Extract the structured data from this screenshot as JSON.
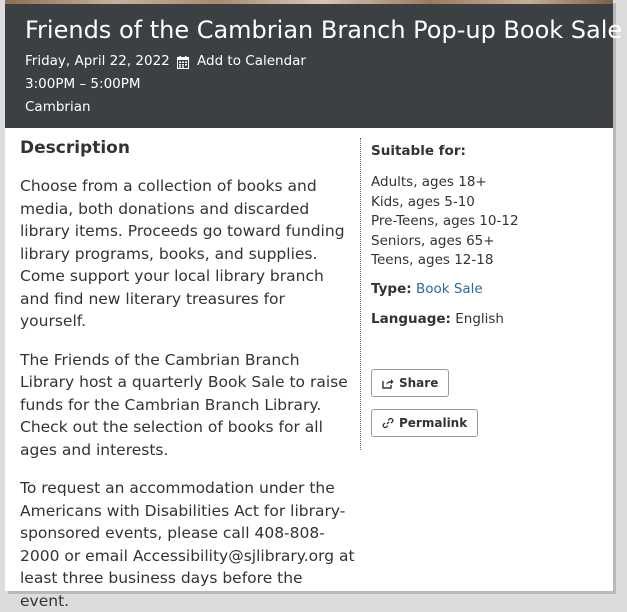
{
  "event": {
    "title": "Friends of the Cambrian Branch Pop-up Book Sale",
    "date": "Friday, April 22, 2022",
    "add_to_calendar": "Add to Calendar",
    "time": "3:00PM – 5:00PM",
    "location": "Cambrian"
  },
  "description": {
    "heading": "Description",
    "paragraphs": [
      "Choose from a collection of books and media, both donations and discarded library items. Proceeds go toward funding library programs, books, and supplies. Come support your local library branch and find new literary treasures for yourself.",
      "The Friends of the Cambrian Branch Library host a quarterly Book Sale to raise funds for the Cambrian  Branch Library. Check out the selection of books for all ages and interests.",
      "To request an accommodation under the Americans with Disabilities Act for library-sponsored events, please call 408-808-2000 or email Accessibility@sjlibrary.org at least three business days before the event."
    ]
  },
  "details": {
    "suitable_for_label": "Suitable for:",
    "audiences": [
      "Adults, ages 18+",
      "Kids, ages 5-10",
      "Pre-Teens, ages 10-12",
      "Seniors, ages 65+",
      "Teens, ages 12-18"
    ],
    "type_label": "Type:",
    "type_value": "Book Sale",
    "language_label": "Language:",
    "language_value": "English"
  },
  "actions": {
    "share_label": "Share",
    "permalink_label": "Permalink"
  },
  "colors": {
    "header_bg": "#3d4043",
    "link": "#2b6a9e"
  }
}
